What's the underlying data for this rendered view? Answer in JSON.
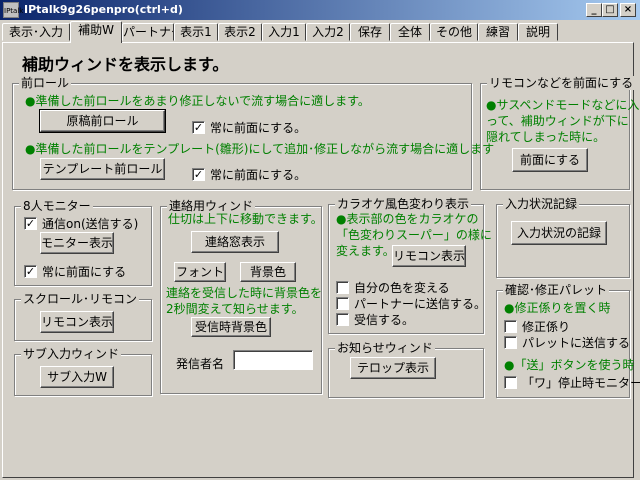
{
  "window": {
    "title": "IPtalk9g26penpro(ctrl+d)",
    "icon_text": "IPtalk",
    "min_label": "_",
    "max_label": "□",
    "close_label": "×"
  },
  "tabs": [
    "表示･入力",
    "補助W",
    "パートナー",
    "表示1",
    "表示2",
    "入力1",
    "入力2",
    "保存",
    "全体",
    "その他",
    "練習",
    "説明"
  ],
  "heading": "補助ウィンドを表示します。",
  "front_roll": {
    "legend": "前ロール",
    "note1": "●準備した前ロールをあまり修正しないで流す場合に適します。",
    "btn1": "原稿前ロール",
    "cb1": "常に前面にする。",
    "note2": "●準備した前ロールをテンプレート(雛形)にして追加･修正しながら流す場合に適します",
    "btn2": "テンプレート前ロール",
    "cb2": "常に前面にする。"
  },
  "remote_front": {
    "legend": "リモコンなどを前面にする",
    "note_l1": "●サスペンドモードなどに入",
    "note_l2": "って、補助ウィンドが下に",
    "note_l3": "隠れてしまった時に。",
    "btn": "前面にする"
  },
  "monitor8": {
    "legend": "8人モニター",
    "cb_comm": "通信on(送信する)",
    "btn": "モニター表示",
    "cb_front": "常に前面にする"
  },
  "scroll_remote": {
    "legend": "スクロール･リモコン",
    "btn": "リモコン表示"
  },
  "sub_input": {
    "legend": "サブ入力ウィンド",
    "btn": "サブ入力W"
  },
  "contact": {
    "legend": "連絡用ウィンド",
    "note": "仕切は上下に移動できます。",
    "btn_show": "連絡窓表示",
    "btn_font": "フォント",
    "btn_bg": "背景色",
    "note2_l1": "連絡を受信した時に背景色を",
    "note2_l2": "2秒間変えて知らせます。",
    "btn_recv_bg": "受信時背景色",
    "sender_label": "発信者名",
    "sender_value": ""
  },
  "karaoke": {
    "legend": "カラオケ風色変わり表示",
    "note_l1": "●表示部の色をカラオケの",
    "note_l2": "「色変わりスーパー」の様に",
    "note_l3": "変えます。",
    "btn": "リモコン表示",
    "cb_self": "自分の色を変える",
    "cb_partner": "パートナーに送信する。",
    "cb_recv": "受信する。"
  },
  "notice": {
    "legend": "お知らせウィンド",
    "btn": "テロップ表示"
  },
  "input_log": {
    "legend": "入力状況記録",
    "btn": "入力状況の記録"
  },
  "confirm_palette": {
    "legend": "確認･修正パレット",
    "note1": "●修正係りを置く時",
    "cb_fix": "修正係り",
    "cb_palette": "パレットに送信する",
    "note2": "●「送」ボタンを使う時",
    "cb_wa": "「ワ」停止時モニター"
  }
}
